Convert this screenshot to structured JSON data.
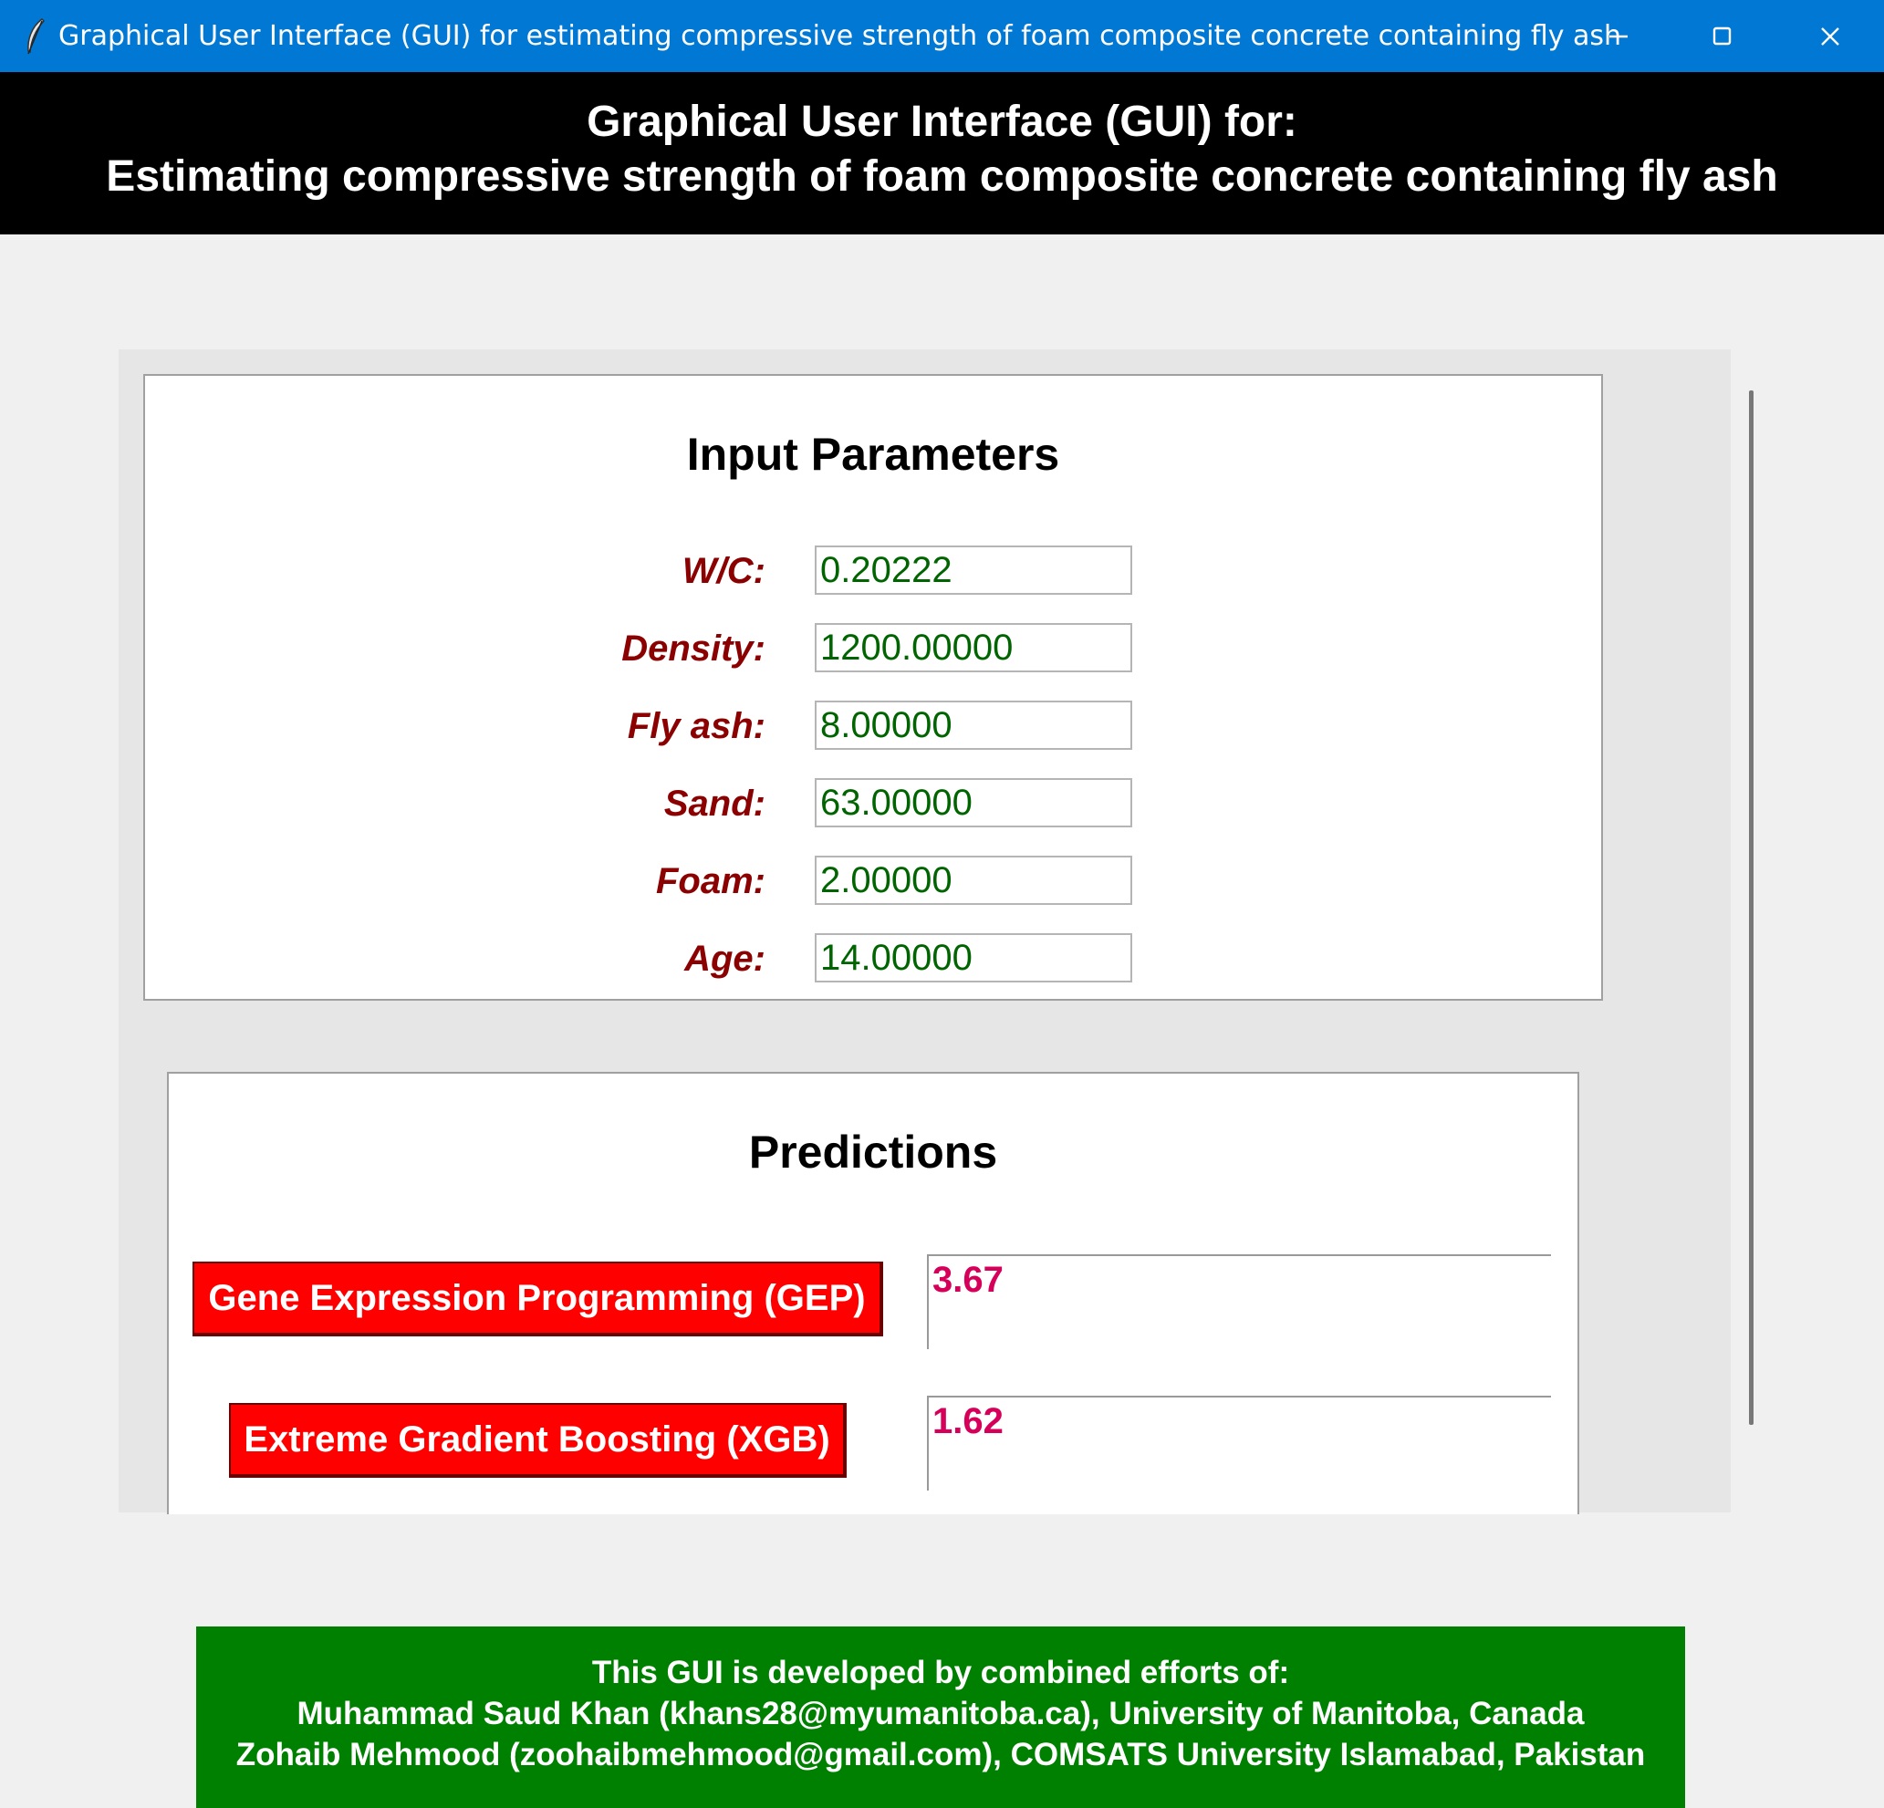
{
  "window": {
    "title": "Graphical User Interface (GUI) for estimating compressive strength of foam composite concrete containing fly ash"
  },
  "header": {
    "line1": "Graphical User Interface (GUI) for:",
    "line2": "Estimating compressive strength of foam composite concrete containing fly ash"
  },
  "inputs": {
    "title": "Input Parameters",
    "params": [
      {
        "label": "W/C:",
        "value": "0.20222"
      },
      {
        "label": "Density:",
        "value": "1200.00000"
      },
      {
        "label": "Fly ash:",
        "value": "8.00000"
      },
      {
        "label": "Sand:",
        "value": "63.00000"
      },
      {
        "label": "Foam:",
        "value": "2.00000"
      },
      {
        "label": "Age:",
        "value": "14.00000"
      }
    ]
  },
  "predictions": {
    "title": "Predictions",
    "models": [
      {
        "label": "Gene Expression Programming (GEP)",
        "result": "3.67"
      },
      {
        "label": "Extreme Gradient Boosting (XGB)",
        "result": "1.62"
      }
    ]
  },
  "footer": {
    "line1": "This GUI is developed by combined efforts of:",
    "line2": "Muhammad Saud Khan (khans28@myumanitoba.ca), University of Manitoba, Canada",
    "line3": "Zohaib Mehmood (zoohaibmehmood@gmail.com), COMSATS University Islamabad, Pakistan"
  },
  "colors": {
    "titlebar": "#0078d4",
    "param_label": "#8b0000",
    "param_value": "#006400",
    "model_button": "#ff0000",
    "result_text": "#d6005a",
    "footer_bg": "#008000"
  }
}
